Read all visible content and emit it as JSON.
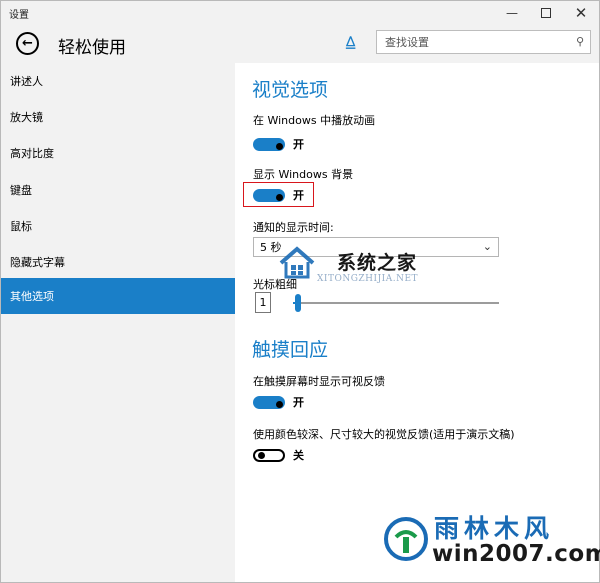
{
  "window": {
    "title": "设置"
  },
  "header": {
    "page_title": "轻松使用",
    "search_placeholder": "查找设置"
  },
  "sidebar": {
    "items": [
      {
        "label": "讲述人"
      },
      {
        "label": "放大镜"
      },
      {
        "label": "高对比度"
      },
      {
        "label": "键盘"
      },
      {
        "label": "鼠标"
      },
      {
        "label": "隐藏式字幕"
      },
      {
        "label": "其他选项"
      }
    ],
    "active_index": 6
  },
  "visual": {
    "heading": "视觉选项",
    "play_animations_label": "在 Windows 中播放动画",
    "play_animations_state": "开",
    "show_background_label": "显示 Windows 背景",
    "show_background_state": "开",
    "notify_time_label": "通知的显示时间:",
    "notify_time_value": "5 秒",
    "cursor_thickness_label": "光标粗细",
    "cursor_thickness_value": 1
  },
  "touch": {
    "heading": "触摸回应",
    "visual_feedback_label": "在触摸屏幕时显示可视反馈",
    "visual_feedback_state": "开",
    "darker_feedback_label": "使用颜色较深、尺寸较大的视觉反馈(适用于演示文稿)",
    "darker_feedback_state": "关"
  },
  "watermarks": {
    "center_title": "系统之家",
    "center_sub": "XITONGZHIJIA.NET",
    "brand_name": "雨林木风",
    "brand_url": "win2007.com"
  },
  "colors": {
    "accent": "#1a7fc8",
    "highlight": "#d8161c"
  },
  "icons": {
    "back": "arrow-left-icon",
    "pin": "pin-icon",
    "search": "magnifier-icon",
    "minimize": "minimize-icon",
    "maximize": "maximize-icon",
    "close": "close-icon"
  }
}
